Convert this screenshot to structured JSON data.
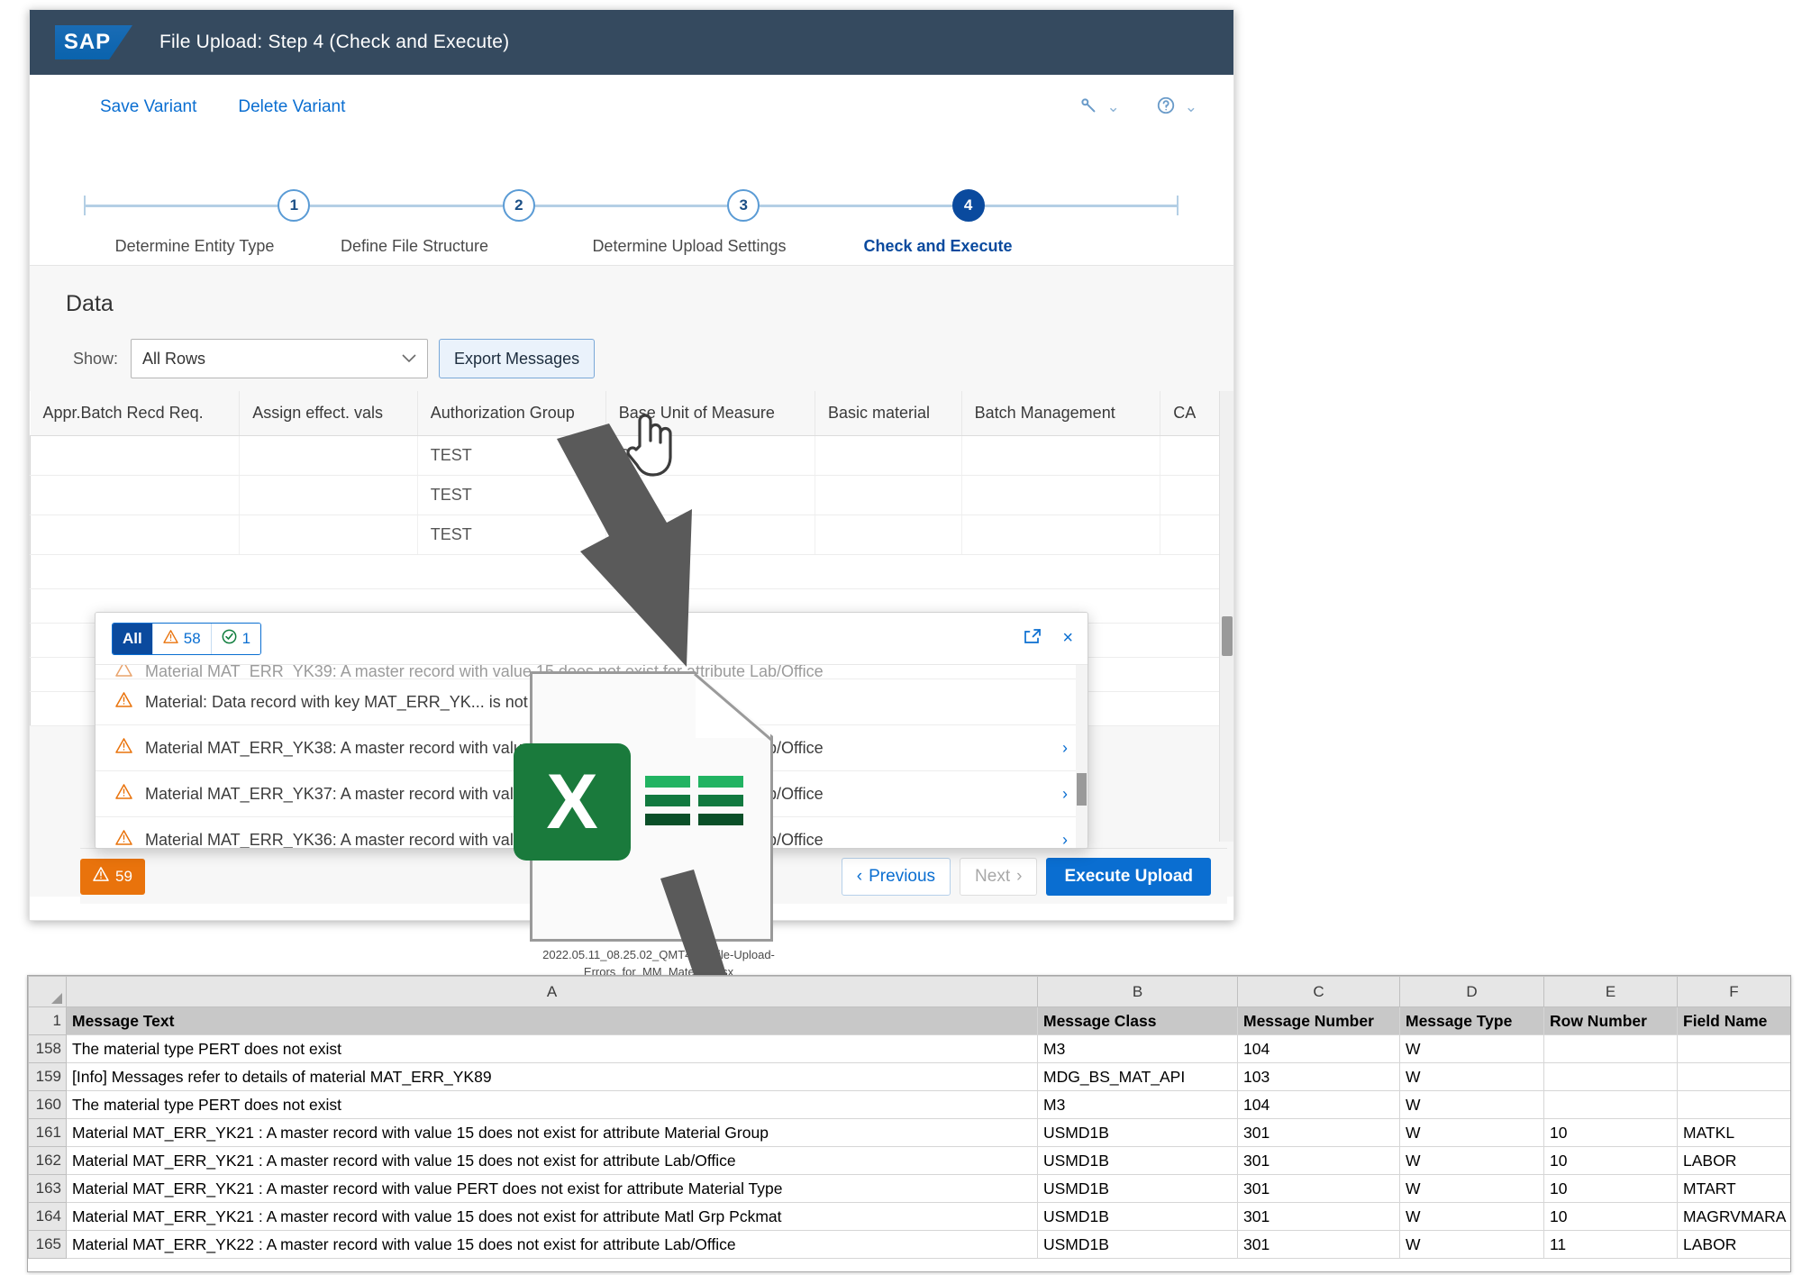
{
  "shell": {
    "logo_text": "SAP",
    "title": "File Upload: Step 4  (Check and Execute)"
  },
  "toolbar": {
    "save_variant": "Save Variant",
    "delete_variant": "Delete Variant",
    "settings_icon": "wrench-icon",
    "help_icon": "question-circle-icon",
    "chevron": "⌄"
  },
  "wizard": {
    "steps": [
      {
        "number": "1",
        "label": "Determine Entity Type",
        "active": false
      },
      {
        "number": "2",
        "label": "Define File Structure",
        "active": false
      },
      {
        "number": "3",
        "label": "Determine Upload Settings",
        "active": false
      },
      {
        "number": "4",
        "label": "Check and Execute",
        "active": true
      }
    ]
  },
  "data_section": {
    "title": "Data",
    "show_label": "Show:",
    "show_value": "All Rows",
    "export_button": "Export Messages",
    "columns": [
      "Appr.Batch Recd Req.",
      "Assign effect. vals",
      "Authorization Group",
      "Base Unit of Measure",
      "Basic material",
      "Batch Management",
      "CA"
    ],
    "rows": [
      {
        "appr_batch": "",
        "assign_eff": "",
        "auth_group": "TEST",
        "base_uom": "PC",
        "basic_material": "",
        "batch_mgmt": "",
        "ca": ""
      },
      {
        "appr_batch": "",
        "assign_eff": "",
        "auth_group": "TEST",
        "base_uom": "PC",
        "basic_material": "",
        "batch_mgmt": "",
        "ca": ""
      },
      {
        "appr_batch": "",
        "assign_eff": "",
        "auth_group": "TEST",
        "base_uom": "PC",
        "basic_material": "",
        "batch_mgmt": "",
        "ca": ""
      }
    ]
  },
  "message_popover": {
    "tab_all": "All",
    "warning_count": "58",
    "success_count": "1",
    "warning_icon": "warning-triangle-icon",
    "success_icon": "check-circle-icon",
    "maximize_icon": "open-in-new-icon",
    "close_icon": "×",
    "messages": [
      {
        "text": "Material MAT_ERR_YK39: A master record with value 15 does not exist for attribute Lab/Office",
        "has_chevron": true,
        "partial": true
      },
      {
        "text": "Material: Data record with key MAT_ERR_YK... is not available",
        "has_chevron": false,
        "partial": false
      },
      {
        "text": "Material MAT_ERR_YK38: A master record with value 15 does not exist for attribute Lab/Office",
        "has_chevron": true,
        "partial": false
      },
      {
        "text": "Material MAT_ERR_YK37: A master record with value 15 does not exist for attribute Lab/Office",
        "has_chevron": true,
        "partial": false
      },
      {
        "text": "Material MAT_ERR_YK36: A master record with value 15 does not exist for attribute Lab/Office",
        "has_chevron": true,
        "partial": false
      }
    ]
  },
  "footer": {
    "warning_badge_count": "59",
    "warning_badge_icon": "warning-triangle-icon",
    "previous": "Previous",
    "next": "Next",
    "execute_upload": "Execute Upload",
    "prev_chevron": "‹",
    "next_chevron": "›"
  },
  "excel_file": {
    "badge_letter": "X",
    "filename": "2022.05.11_08.25.02_QMT407_File-Upload-Errors_for_MM_Material.xlsx"
  },
  "spreadsheet": {
    "column_letters": [
      "A",
      "B",
      "C",
      "D",
      "E",
      "F"
    ],
    "header_row_number": "1",
    "headers": [
      "Message Text",
      "Message Class",
      "Message Number",
      "Message Type",
      "Row Number",
      "Field Name"
    ],
    "rows": [
      {
        "n": "158",
        "cells": [
          "The material type PERT does not exist",
          "M3",
          "104",
          "W",
          "",
          ""
        ]
      },
      {
        "n": "159",
        "cells": [
          "[Info] Messages refer to details of material MAT_ERR_YK89",
          "MDG_BS_MAT_API",
          "103",
          "W",
          "",
          ""
        ]
      },
      {
        "n": "160",
        "cells": [
          "The material type PERT does not exist",
          "M3",
          "104",
          "W",
          "",
          ""
        ]
      },
      {
        "n": "161",
        "cells": [
          "Material MAT_ERR_YK21 : A master record with value 15 does not exist for attribute Material Group",
          "USMD1B",
          "301",
          "W",
          "10",
          "MATKL"
        ]
      },
      {
        "n": "162",
        "cells": [
          "Material MAT_ERR_YK21 : A master record with value 15 does not exist for attribute Lab/Office",
          "USMD1B",
          "301",
          "W",
          "10",
          "LABOR"
        ]
      },
      {
        "n": "163",
        "cells": [
          "Material MAT_ERR_YK21 : A master record with value PERT does not exist for attribute Material Type",
          "USMD1B",
          "301",
          "W",
          "10",
          "MTART"
        ]
      },
      {
        "n": "164",
        "cells": [
          "Material MAT_ERR_YK21 : A master record with value 15 does not exist for attribute Matl Grp Pckmat",
          "USMD1B",
          "301",
          "W",
          "10",
          "MAGRVMARA"
        ]
      },
      {
        "n": "165",
        "cells": [
          "Material MAT_ERR_YK22 : A master record with value 15 does not exist for attribute Lab/Office",
          "USMD1B",
          "301",
          "W",
          "11",
          "LABOR"
        ]
      }
    ]
  },
  "colors": {
    "shell_bg": "#354a5f",
    "accent_blue": "#0a6ed1",
    "active_step": "#0a4a9e",
    "warning_orange": "#e9730c",
    "success_green": "#107e3e",
    "excel_green": "#1a7a3c",
    "arrow_gray": "#5a5a5a"
  }
}
